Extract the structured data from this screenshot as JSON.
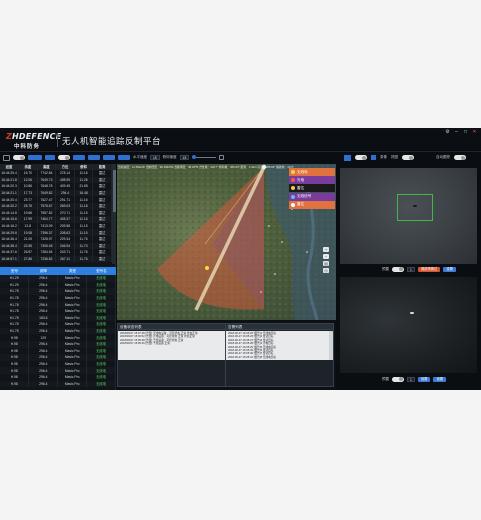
{
  "header": {
    "logo_en_first": "Z",
    "logo_en_rest": "HDEFENCE",
    "logo_cn": "中科防务",
    "title": "无人机智能追踪反制平台",
    "window_controls": [
      "settings-icon",
      "minimize-icon",
      "maximize-icon",
      "close-icon"
    ]
  },
  "toolbar": {
    "chips": [
      "",
      "",
      "",
      "",
      ""
    ],
    "speed_label": "水平速度",
    "speed_value": "15",
    "angle_label": "俯仰速度",
    "angle_value": "15"
  },
  "video_toolbar": {
    "record_label": "录像",
    "snapshot_label": "抓图",
    "auto_label": "自动跟踪"
  },
  "map_info": "当前速度：12.35km/h  当前经度：96.23467E  当前纬度：45.18°N  方位角：116.7°  俯仰角：200.64°  距离：1.3km  高度：195.84°  偏航角：20.5°",
  "legend": [
    {
      "label": "无线电",
      "color": "#e0723f",
      "dot": "#f1d04a"
    },
    {
      "label": "光电",
      "color": "#7a3c9c",
      "dot": "#f05b4a"
    },
    {
      "label": "雷达",
      "color": "#1a1a1a",
      "dot": "#e9d04a"
    },
    {
      "label": "无线信号",
      "color": "#7a3c9c",
      "dot": "#55c0f0"
    },
    {
      "label": "雷达",
      "color": "#e0723f",
      "dot": "#ffffff"
    }
  ],
  "table1": {
    "headers": [
      "经度",
      "纬度",
      "高度",
      "方位",
      "俯仰",
      "距离"
    ],
    "rows": [
      [
        "16:44:25.4",
        "16.70",
        "7742.84",
        "278.14",
        "11.16",
        "雷达"
      ],
      [
        "16:44:21.8",
        "12.06",
        "7649.73",
        "498.99",
        "11.26",
        "雷达"
      ],
      [
        "16:44:20.3",
        "10.86",
        "7648.78",
        "409.49",
        "21.65",
        "雷达"
      ],
      [
        "16:44:21.1",
        "17.73",
        "7649.82",
        "294.4",
        "16.48",
        "雷达"
      ],
      [
        "16:44:20.4",
        "23.77",
        "7627.47",
        "291.71",
        "11.16",
        "雷达"
      ],
      [
        "16:44:20.2",
        "25.75",
        "7578.67",
        "269.03",
        "11.18",
        "雷达"
      ],
      [
        "16:44:14.8",
        "19.68",
        "7557.82",
        "270.71",
        "11.15",
        "雷达"
      ],
      [
        "16:44:15.6",
        "17.99",
        "7464.77",
        "405.37",
        "11.16",
        "雷达"
      ],
      [
        "16:44:16.2",
        "21.8",
        "7413.09",
        "209.58",
        "11.15",
        "雷达"
      ],
      [
        "16:44:29.6",
        "19.08",
        "7396.37",
        "208.63",
        "11.15",
        "雷达"
      ],
      [
        "16:44:36.4",
        "21.05",
        "7328.97",
        "229.34",
        "11.76",
        "雷达"
      ],
      [
        "16:44:38.4",
        "22.55",
        "7306.45",
        "246.94",
        "11.73",
        "雷达"
      ],
      [
        "16:44:37.6",
        "26.87",
        "7284.54",
        "243.71",
        "11.76",
        "雷达"
      ],
      [
        "16:44:57.1",
        "27.86",
        "7236.82",
        "267.11",
        "11.76",
        "雷达"
      ]
    ]
  },
  "table2": {
    "headers": [
      "型号",
      "频率",
      "类型",
      "型号名"
    ],
    "rows": [
      [
        "H1.29",
        "296.4",
        "Mavic Pro",
        "无线电"
      ],
      [
        "H1.29",
        "296.4",
        "Mavic Pro",
        "无线电"
      ],
      [
        "H1.78",
        "296.4",
        "Mavic Pro",
        "无线电"
      ],
      [
        "H1.78",
        "296.4",
        "Mavic Pro",
        "无线电"
      ],
      [
        "H1.78",
        "296.4",
        "Mavic Pro",
        "无线电"
      ],
      [
        "H1.78",
        "296.4",
        "Mavic Pro",
        "无线电"
      ],
      [
        "H1.78",
        "183.6",
        "Mavic Pro",
        "无线电"
      ],
      [
        "H1.78",
        "296.4",
        "Mavic Pro",
        "无线电"
      ],
      [
        "H1.78",
        "296.4",
        "Mavic Pro",
        "无线电"
      ],
      [
        "H.98",
        "129",
        "Mavic Pro",
        "无线电"
      ],
      [
        "H.98",
        "296.4",
        "Mavic Pro",
        "无线电"
      ],
      [
        "H.98",
        "296.4",
        "Mavic Pro",
        "无线电"
      ],
      [
        "H.98",
        "296.4",
        "Mavic Pro",
        "无线电"
      ],
      [
        "H.98",
        "296.4",
        "Mavic Pro",
        "无线电"
      ],
      [
        "H.98",
        "296.4",
        "Mavic Pro",
        "无线电"
      ],
      [
        "H.98",
        "296.4",
        "Mavic Pro",
        "无线电"
      ],
      [
        "H.98",
        "296.4",
        "Mavic Pro",
        "无线电"
      ]
    ]
  },
  "log_left": {
    "title": "设备状态列表",
    "lines": [
      "2018/06/27 15:07:48 [告警]  无线电设备：可控状态 正常 状态正常",
      "2018/06/27 15:06:52 [告警]  光电设备：可控状态 正常 状态正常",
      "2018/06/27 15:05:48 [告警]  干扰设备：可控状态 正常",
      "2018/06/27 15:05:46 [告警]  干扰设备 正常"
    ]
  },
  "log_right": {
    "title": "告警列表",
    "lines": [
      "2018-06-27 16:05:26 [警告]1 无线电目标",
      "2018-06-27 16:05:26 [警告]2 雷达目标",
      "2018-06-27 16:05:27 [警告]3 雷达目标",
      "2018-06-27 16:05:28 [警告]4 光电目标",
      "2018-06-27 16:05:29 [警告]5 无线电目标",
      "2018-06-27 16:05:30 [警告]6 雷达目标",
      "2018-06-27 16:05:30 [警告]7 雷达目标",
      "2018-06-27 16:05:31 [警告]8 无线电目标"
    ]
  },
  "video1_controls": {
    "label": "预置",
    "value": "1",
    "btn1": "调用预置位",
    "btn2": "设置"
  },
  "video2_controls": {
    "label": "预置",
    "value": "1",
    "btn1": "设置",
    "btn2": "设置"
  }
}
